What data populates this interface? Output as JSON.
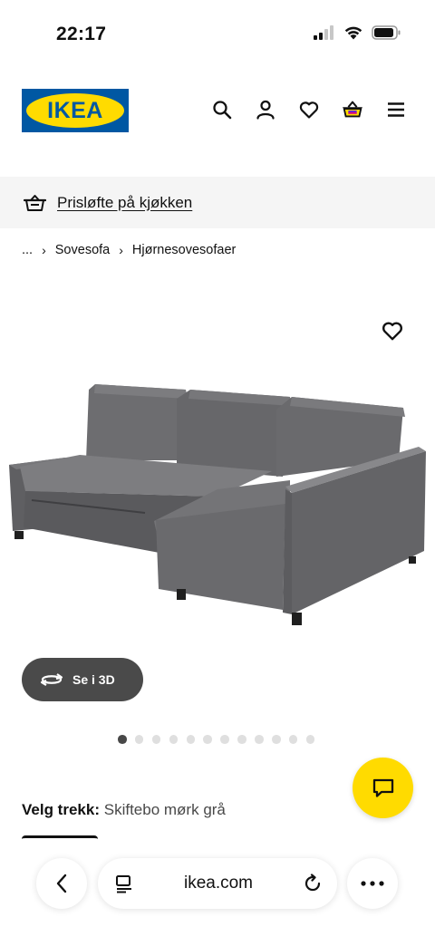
{
  "status_bar": {
    "time": "22:17",
    "icons": [
      "cellular-signal-icon",
      "wifi-icon",
      "battery-icon"
    ]
  },
  "header": {
    "logo_text": "IKEA",
    "icons": [
      "search-icon",
      "user-icon",
      "heart-icon",
      "basket-icon",
      "menu-icon"
    ]
  },
  "promo": {
    "icon": "basket-icon",
    "text": "Prisløfte på kjøkken"
  },
  "breadcrumb": {
    "ellipsis": "...",
    "items": [
      "Sovesofa",
      "Hjørnesovesofaer"
    ]
  },
  "product": {
    "image": "grey-corner-sofa-bed",
    "view3d_label": "Se i 3D",
    "carousel": {
      "total": 12,
      "active": 1
    }
  },
  "variant": {
    "label": "Velg trekk:",
    "value": "Skiftebo mørk grå"
  },
  "browser": {
    "url": "ikea.com"
  },
  "colors": {
    "ikea_blue": "#0058a3",
    "ikea_yellow": "#ffdb00",
    "promo_bg": "#f5f5f5",
    "button_dark": "#4a4a4a"
  }
}
